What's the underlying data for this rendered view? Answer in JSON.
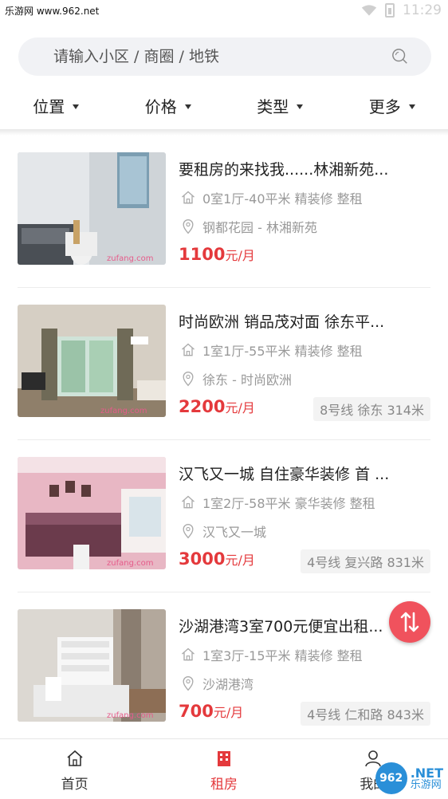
{
  "status_bar": {
    "watermark": "乐游网 www.962.net",
    "time": "11:29"
  },
  "search": {
    "placeholder": "请输入小区 / 商圈 / 地铁"
  },
  "filters": [
    {
      "label": "位置"
    },
    {
      "label": "价格"
    },
    {
      "label": "类型"
    },
    {
      "label": "更多"
    }
  ],
  "listings": [
    {
      "title": "要租房的来找我......林湘新苑...",
      "spec": "0室1厅-40平米 精装修 整租",
      "location": "钢都花园 - 林湘新苑",
      "price": "1100",
      "unit": "元/月",
      "metro": "",
      "watermark": "zufang.com"
    },
    {
      "title": "时尚欧洲 销品茂对面 徐东平...",
      "spec": "1室1厅-55平米 精装修 整租",
      "location": "徐东 - 时尚欧洲",
      "price": "2200",
      "unit": "元/月",
      "metro": "8号线 徐东 314米",
      "watermark": "zufang.com"
    },
    {
      "title": "汉飞又一城 自住豪华装修 首 ...",
      "spec": "1室2厅-58平米 豪华装修 整租",
      "location": "汉飞又一城",
      "price": "3000",
      "unit": "元/月",
      "metro": "4号线 复兴路 831米",
      "watermark": "zufang.com"
    },
    {
      "title": "沙湖港湾3室700元便宜出租...",
      "spec": "1室3厅-15平米 精装修 整租",
      "location": "沙湖港湾",
      "price": "700",
      "unit": "元/月",
      "metro": "4号线 仁和路 843米",
      "watermark": "zufang.com"
    }
  ],
  "bottom_nav": [
    {
      "label": "首页"
    },
    {
      "label": "租房"
    },
    {
      "label": "我的"
    }
  ],
  "watermark_bottom": {
    "badge": "962",
    "brand": ".NET",
    "sub": "乐游网"
  },
  "colors": {
    "accent": "#e4393c",
    "fab": "#f0525d"
  }
}
